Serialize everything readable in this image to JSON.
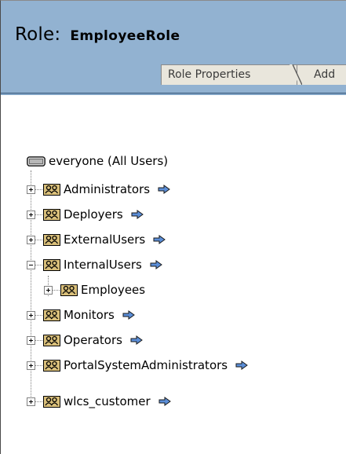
{
  "header": {
    "role_label": "Role:",
    "role_name": "EmployeeRole"
  },
  "tabs": [
    {
      "label": "Role Properties"
    },
    {
      "label": "Add"
    }
  ],
  "tree": {
    "root_label": "everyone (All Users)",
    "nodes": [
      {
        "label": "Administrators"
      },
      {
        "label": "Deployers"
      },
      {
        "label": "ExternalUsers"
      },
      {
        "label": "InternalUsers"
      },
      {
        "label": "Employees"
      },
      {
        "label": "Monitors"
      },
      {
        "label": "Operators"
      },
      {
        "label": "PortalSystemAdministrators"
      },
      {
        "label": "wlcs_customer"
      }
    ]
  },
  "colors": {
    "header_bg": "#92b2d1",
    "tab_bg": "#e9e6dc",
    "arrow_fill": "#5b8ed8",
    "group_icon_bg": "#d9bf7a"
  },
  "icons": {
    "root": "server-icon",
    "group": "group-icon",
    "action": "arrow-right-icon"
  }
}
